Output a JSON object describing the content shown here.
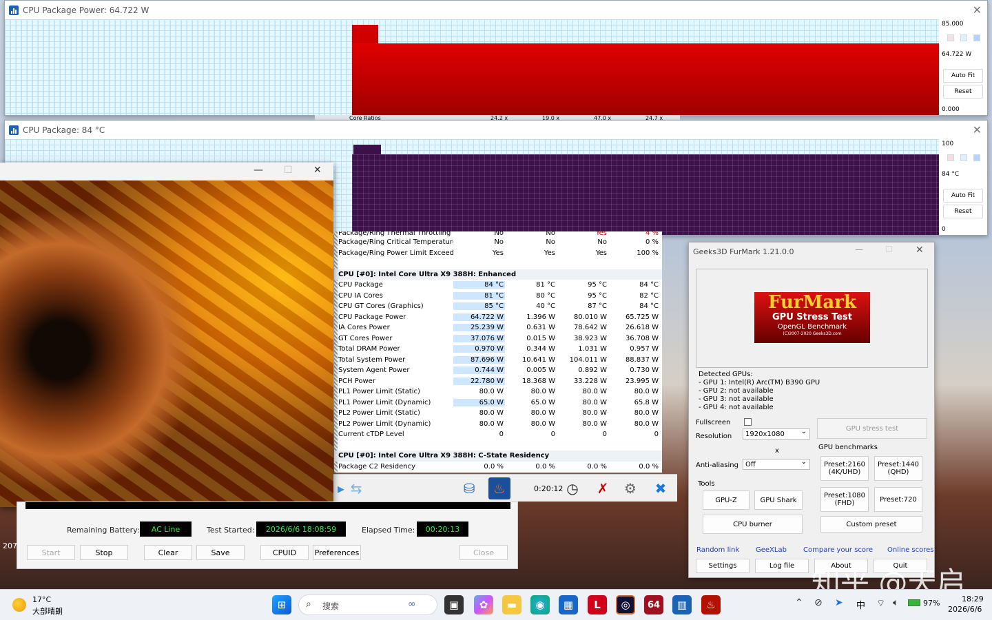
{
  "power_window": {
    "title": "CPU Package Power: 64.722 W",
    "max_label": "85.000",
    "current_label": "64.722 W",
    "min_label": "0.000",
    "auto_fit": "Auto Fit",
    "reset": "Reset",
    "underlying_row": {
      "label": "Core Ratios",
      "values": [
        "24.2 x",
        "19.0 x",
        "47.0 x",
        "24.7 x"
      ]
    },
    "fill_color": "#c00000"
  },
  "temp_window": {
    "title": "CPU Package: 84 °C",
    "max_label": "100",
    "current_label": "84 °C",
    "min_label": "0",
    "auto_fit": "Auto Fit",
    "reset": "Reset",
    "fill_color": "#3a0f45"
  },
  "sensor_table": {
    "top_rows": [
      {
        "name": "Package/Ring Thermal Throttling",
        "v": [
          "No",
          "No",
          "Yes",
          "4 %"
        ]
      },
      {
        "name": "Package/Ring Critical Temperature",
        "v": [
          "No",
          "No",
          "No",
          "0 %"
        ]
      },
      {
        "name": "Package/Ring Power Limit Exceeded",
        "v": [
          "Yes",
          "Yes",
          "Yes",
          "100 %"
        ]
      }
    ],
    "section1": "CPU [#0]: Intel Core Ultra X9 388H: Enhanced",
    "rows": [
      {
        "name": "CPU Package",
        "v": [
          "84 °C",
          "81 °C",
          "95 °C",
          "84 °C"
        ]
      },
      {
        "name": "CPU IA Cores",
        "v": [
          "81 °C",
          "80 °C",
          "95 °C",
          "82 °C"
        ]
      },
      {
        "name": "CPU GT Cores (Graphics)",
        "v": [
          "85 °C",
          "40 °C",
          "87 °C",
          "84 °C"
        ]
      },
      {
        "name": "CPU Package Power",
        "v": [
          "64.722 W",
          "1.396 W",
          "80.010 W",
          "65.725 W"
        ]
      },
      {
        "name": "IA Cores Power",
        "v": [
          "25.239 W",
          "0.631 W",
          "78.642 W",
          "26.618 W"
        ]
      },
      {
        "name": "GT Cores Power",
        "v": [
          "37.076 W",
          "0.015 W",
          "38.923 W",
          "36.708 W"
        ]
      },
      {
        "name": "Total DRAM Power",
        "v": [
          "0.970 W",
          "0.344 W",
          "1.031 W",
          "0.957 W"
        ]
      },
      {
        "name": "Total System Power",
        "v": [
          "87.696 W",
          "10.641 W",
          "104.011 W",
          "88.837 W"
        ]
      },
      {
        "name": "System Agent Power",
        "v": [
          "0.744 W",
          "0.005 W",
          "0.892 W",
          "0.730 W"
        ]
      },
      {
        "name": "PCH Power",
        "v": [
          "22.780 W",
          "18.368 W",
          "33.228 W",
          "23.995 W"
        ]
      },
      {
        "name": "PL1 Power Limit (Static)",
        "v": [
          "80.0 W",
          "80.0 W",
          "80.0 W",
          "80.0 W"
        ]
      },
      {
        "name": "PL1 Power Limit (Dynamic)",
        "v": [
          "65.0 W",
          "65.0 W",
          "80.0 W",
          "65.8 W"
        ]
      },
      {
        "name": "PL2 Power Limit (Static)",
        "v": [
          "80.0 W",
          "80.0 W",
          "80.0 W",
          "80.0 W"
        ]
      },
      {
        "name": "PL2 Power Limit (Dynamic)",
        "v": [
          "80.0 W",
          "80.0 W",
          "80.0 W",
          "80.0 W"
        ]
      },
      {
        "name": "Current cTDP Level",
        "v": [
          "0",
          "0",
          "0",
          "0"
        ]
      }
    ],
    "section2": "CPU [#0]: Intel Core Ultra X9 388H: C-State Residency",
    "last_row": {
      "name": "Package C2 Residency",
      "v": [
        "0.0 %",
        "0.0 %",
        "0.0 %",
        "0.0 %"
      ]
    }
  },
  "hwinfo_toolbar": {
    "elapsed": "0:20:12"
  },
  "stress_dialog": {
    "remaining_battery_label": "Remaining Battery:",
    "remaining_battery_value": "AC Line",
    "test_started_label": "Test Started:",
    "test_started_value": "2026/6/6 18:08:59",
    "elapsed_label": "Elapsed Time:",
    "elapsed_value": "00:20:13",
    "buttons": {
      "start": "Start",
      "stop": "Stop",
      "clear": "Clear",
      "save": "Save",
      "cpuid": "CPUID",
      "preferences": "Preferences",
      "close": "Close"
    },
    "side_number": "207"
  },
  "furmark": {
    "title": "Geeks3D FurMark 1.21.0.0",
    "logo_main": "FurMark",
    "logo_sub": "GPU Stress Test",
    "logo_sub2": "OpenGL Benchmark",
    "logo_copy": "(C)2007-2020 Geeks3D.com",
    "detected_title": "Detected GPUs:",
    "gpus": [
      "- GPU 1: Intel(R) Arc(TM) B390 GPU",
      "- GPU 2: not available",
      "- GPU 3: not available",
      "- GPU 4: not available"
    ],
    "fullscreen": "Fullscreen",
    "resolution_label": "Resolution",
    "resolution_value": "1920x1080",
    "x_label": "x",
    "aa_label": "Anti-aliasing",
    "aa_value": "Off",
    "tools_label": "Tools",
    "gpuz": "GPU-Z",
    "gpushark": "GPU Shark",
    "cpuburner": "CPU burner",
    "stress_test": "GPU stress test",
    "benchmarks_label": "GPU benchmarks",
    "p2160": "Preset:2160\n(4K/UHD)",
    "p1440": "Preset:1440\n(QHD)",
    "p1080": "Preset:1080\n(FHD)",
    "p720": "Preset:720",
    "custom": "Custom preset",
    "links": [
      "Random link",
      "GeeXLab",
      "Compare your score",
      "Online scores"
    ],
    "settings": "Settings",
    "logfile": "Log file",
    "about": "About",
    "quit": "Quit"
  },
  "taskbar": {
    "weather_temp": "17°C",
    "weather_desc": "大部晴朗",
    "search_placeholder": "搜索",
    "lang": "中",
    "battery": "97%",
    "time": "18:29",
    "date": "2026/6/6"
  },
  "watermark": "知乎 @天启"
}
